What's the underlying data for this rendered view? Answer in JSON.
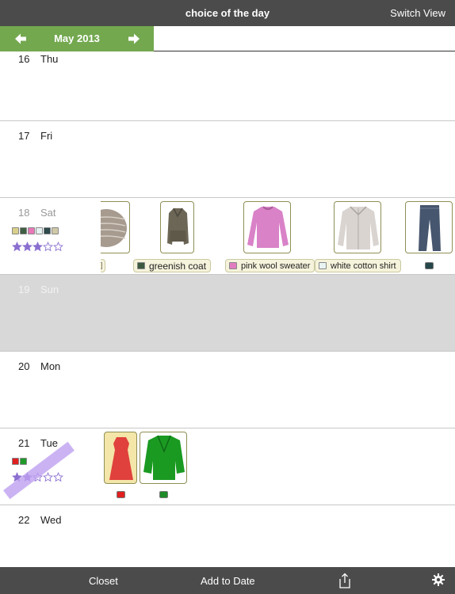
{
  "header": {
    "title": "choice of the day",
    "switch_view": "Switch View"
  },
  "month": {
    "label": "May 2013"
  },
  "days": [
    {
      "num": "16",
      "dow": "Thu"
    },
    {
      "num": "17",
      "dow": "Fri"
    },
    {
      "num": "18",
      "dow": "Sat",
      "rating": 3,
      "swatches": [
        "#d9cf8a",
        "#3f5f45",
        "#e878b8",
        "#e4f1ef",
        "#2e4b4d",
        "#cfc9a8"
      ],
      "items": [
        {
          "name": "",
          "chip": "#e9e0a0"
        },
        {
          "name": "greenish coat",
          "chip": "#3b5a3f"
        },
        {
          "name": "pink wool sweater",
          "chip": "#e27cc1"
        },
        {
          "name": "white cotton shirt",
          "chip": "#e8f4f2"
        },
        {
          "name": "",
          "chip": "#26474a"
        }
      ]
    },
    {
      "num": "19",
      "dow": "Sun"
    },
    {
      "num": "20",
      "dow": "Mon"
    },
    {
      "num": "21",
      "dow": "Tue",
      "rating": 2,
      "swatches": [
        "#e02020",
        "#1f9a2a"
      ],
      "items": [
        {
          "name": "",
          "chip": "#e02020"
        },
        {
          "name": "",
          "chip": "#1e8a28"
        }
      ]
    },
    {
      "num": "22",
      "dow": "Wed"
    }
  ],
  "toolbar": {
    "closet": "Closet",
    "add_to_date": "Add to Date"
  },
  "icons": {
    "prev": "arrow-left-icon",
    "next": "arrow-right-icon",
    "share": "share-icon",
    "settings": "gear-icon",
    "star": "star-icon"
  },
  "colors": {
    "bar": "#4b4b4b",
    "accent": "#73a84f",
    "star": "#8a6fd0"
  }
}
